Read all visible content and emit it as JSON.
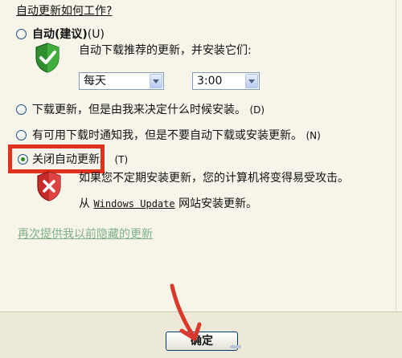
{
  "heading": "自动更新如何工作?",
  "option_auto": {
    "label": "自动(建议)",
    "shortcut": "(U)",
    "description": "自动下载推荐的更新，并安装它们:",
    "day_select": "每天",
    "time_select": "3:00"
  },
  "option_download": {
    "label": "下载更新，但是由我来决定什么时候安装。",
    "shortcut": "(D)"
  },
  "option_notify": {
    "label": "有可用下载时通知我，但是不要自动下载或安装更新。",
    "shortcut": "(N)"
  },
  "option_off": {
    "label": "关闭自动更新。",
    "shortcut": "(T)",
    "warning_line1": "如果您不定期安装更新，您的计算机将变得易受攻击。",
    "warning_from": "从",
    "warning_link": "Windows Update",
    "warning_site": "网站安装更新。"
  },
  "hidden_updates_link": "再次提供我以前隐藏的更新",
  "ok_button": "确定",
  "selected_option": "off",
  "colors": {
    "highlight": "#e0301e",
    "arrow": "#d9382a",
    "shield_green": "#2f8f2e",
    "shield_red": "#c62b2b",
    "link": "#7fb08a"
  },
  "icons": [
    "shield-check-icon",
    "shield-x-icon",
    "red-arrow-annotation"
  ]
}
